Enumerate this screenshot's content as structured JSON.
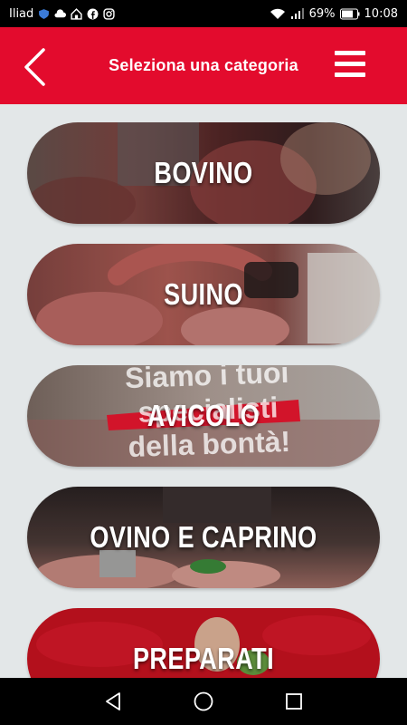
{
  "status_bar": {
    "carrier": "Iliad",
    "battery": "69%",
    "time": "10:08",
    "icons": [
      "shield-icon",
      "cloud-icon",
      "home-icon",
      "facebook-icon",
      "instagram-icon",
      "wifi-icon",
      "signal-icon",
      "battery-icon"
    ]
  },
  "header": {
    "title": "Seleziona una categoria",
    "back_icon": "chevron-left-icon",
    "menu_icon": "hamburger-menu-icon",
    "color": "#e30b2d"
  },
  "categories": [
    {
      "label": "BOVINO"
    },
    {
      "label": "SUINO"
    },
    {
      "label": "AVICOLO",
      "background_text": [
        "Siamo i tuoi",
        "specialisti",
        "della bontà!"
      ]
    },
    {
      "label": "OVINO E CAPRINO"
    },
    {
      "label": "PREPARATI"
    }
  ],
  "nav_bar": {
    "icons": [
      "back-triangle-icon",
      "home-circle-icon",
      "recents-square-icon"
    ]
  }
}
